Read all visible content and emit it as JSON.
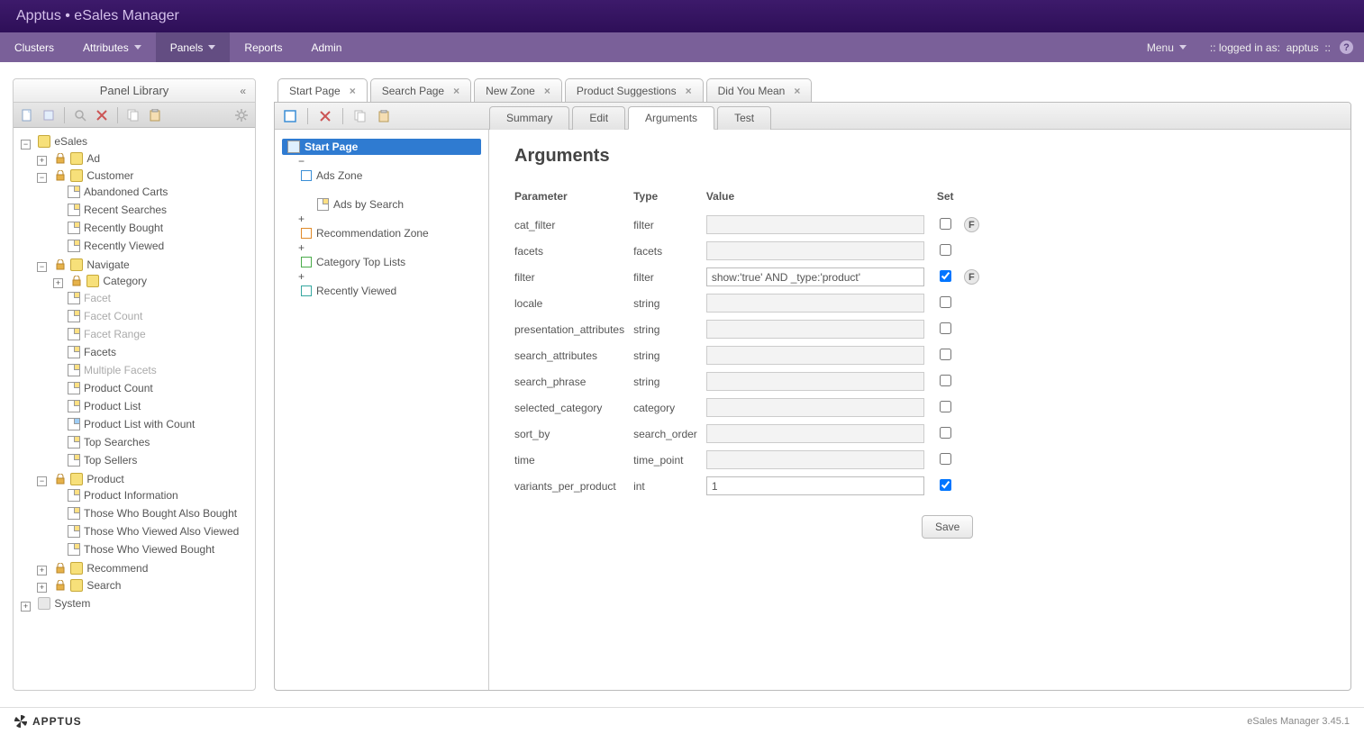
{
  "header": {
    "title": "Apptus • eSales Manager"
  },
  "menubar": {
    "items": [
      "Clusters",
      "Attributes",
      "Panels",
      "Reports",
      "Admin"
    ],
    "active_index": 2,
    "has_dropdown": [
      false,
      true,
      true,
      false,
      false
    ],
    "menu_label": "Menu",
    "logged_prefix": "::  logged in as:",
    "logged_user": "apptus",
    "logged_suffix": "::"
  },
  "panel_library": {
    "title": "Panel Library",
    "tree": {
      "esales": "eSales",
      "ad": "Ad",
      "customer": "Customer",
      "customer_children": [
        "Abandoned Carts",
        "Recent Searches",
        "Recently Bought",
        "Recently Viewed"
      ],
      "navigate": "Navigate",
      "category": "Category",
      "nav_children_muted": [
        "Facet",
        "Facet Count",
        "Facet Range"
      ],
      "nav_children": [
        "Facets"
      ],
      "nav_children_muted2": [
        "Multiple Facets"
      ],
      "nav_children2": [
        "Product Count",
        "Product List",
        "Product List with Count",
        "Top Searches",
        "Top Sellers"
      ],
      "product": "Product",
      "product_children": [
        "Product Information",
        "Those Who Bought Also Bought",
        "Those Who Viewed Also Viewed",
        "Those Who Viewed Bought"
      ],
      "recommend": "Recommend",
      "search": "Search",
      "system": "System"
    }
  },
  "editor": {
    "tabs": [
      "Start Page",
      "Search Page",
      "New Zone",
      "Product Suggestions",
      "Did You Mean"
    ],
    "active_tab": 0,
    "subtabs": [
      "Summary",
      "Edit",
      "Arguments",
      "Test"
    ],
    "active_subtab": 2,
    "navtree": {
      "root": "Start Page",
      "ads_zone": "Ads Zone",
      "ads_by_search": "Ads by Search",
      "recommendation_zone": "Recommendation Zone",
      "category_top_lists": "Category Top Lists",
      "recently_viewed": "Recently Viewed"
    },
    "form": {
      "heading": "Arguments",
      "cols": {
        "param": "Parameter",
        "type": "Type",
        "value": "Value",
        "set": "Set"
      },
      "rows": [
        {
          "param": "cat_filter",
          "type": "filter",
          "value": "",
          "set": false,
          "editable": false,
          "badge": "F"
        },
        {
          "param": "facets",
          "type": "facets",
          "value": "",
          "set": false,
          "editable": false
        },
        {
          "param": "filter",
          "type": "filter",
          "value": "show:'true' AND _type:'product'",
          "set": true,
          "editable": true,
          "badge": "F"
        },
        {
          "param": "locale",
          "type": "string",
          "value": "",
          "set": false,
          "editable": false
        },
        {
          "param": "presentation_attributes",
          "type": "string",
          "value": "",
          "set": false,
          "editable": false
        },
        {
          "param": "search_attributes",
          "type": "string",
          "value": "",
          "set": false,
          "editable": false
        },
        {
          "param": "search_phrase",
          "type": "string",
          "value": "",
          "set": false,
          "editable": false
        },
        {
          "param": "selected_category",
          "type": "category",
          "value": "",
          "set": false,
          "editable": false
        },
        {
          "param": "sort_by",
          "type": "search_order",
          "value": "",
          "set": false,
          "editable": false
        },
        {
          "param": "time",
          "type": "time_point",
          "value": "",
          "set": false,
          "editable": false
        },
        {
          "param": "variants_per_product",
          "type": "int",
          "value": "1",
          "set": true,
          "editable": true
        }
      ],
      "save_label": "Save"
    }
  },
  "footer": {
    "brand": "APPTUS",
    "version": "eSales Manager 3.45.1"
  }
}
